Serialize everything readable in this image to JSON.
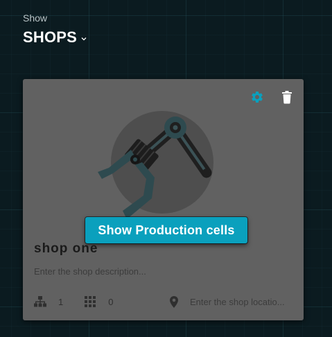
{
  "header": {
    "subtitle": "Show",
    "title": "SHOPS",
    "dropdown_icon": "chevron-down-icon"
  },
  "card": {
    "actions": {
      "settings_icon": "gear-icon",
      "delete_icon": "trash-icon",
      "settings_color": "#0aa0bd"
    },
    "image_icon": "robotic-arm-icon",
    "cta_label": "Show Production cells",
    "shop_name": "shop one",
    "description_placeholder": "Enter the shop description...",
    "stats": {
      "hierarchy_icon": "hierarchy-icon",
      "hierarchy_count": "1",
      "grid_icon": "grid-icon",
      "cell_count": "0"
    },
    "location": {
      "icon": "location-pin-icon",
      "placeholder": "Enter the shop locatio..."
    }
  },
  "colors": {
    "background": "#0b1b20",
    "card": "#616161",
    "accent": "#0aa0bd",
    "title": "#ffffff"
  }
}
